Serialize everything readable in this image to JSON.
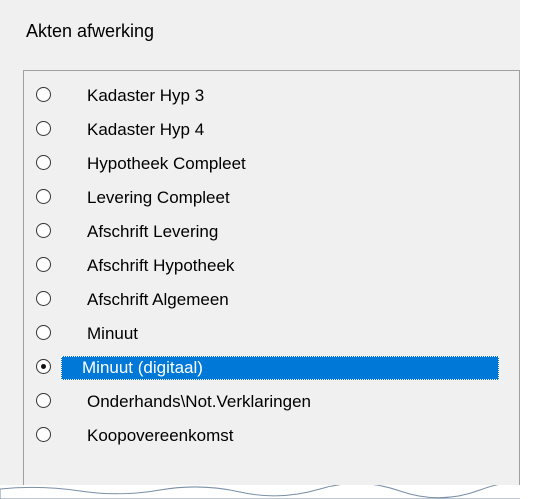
{
  "group": {
    "title": "Akten afwerking"
  },
  "options": [
    {
      "label": "Kadaster Hyp 3",
      "checked": false,
      "selected": false
    },
    {
      "label": "Kadaster Hyp 4",
      "checked": false,
      "selected": false
    },
    {
      "label": "Hypotheek Compleet",
      "checked": false,
      "selected": false
    },
    {
      "label": "Levering Compleet",
      "checked": false,
      "selected": false
    },
    {
      "label": "Afschrift Levering",
      "checked": false,
      "selected": false
    },
    {
      "label": "Afschrift Hypotheek",
      "checked": false,
      "selected": false
    },
    {
      "label": "Afschrift Algemeen",
      "checked": false,
      "selected": false
    },
    {
      "label": "Minuut",
      "checked": false,
      "selected": false
    },
    {
      "label": "Minuut (digitaal)",
      "checked": true,
      "selected": true
    },
    {
      "label": "Onderhands\\Not.Verklaringen",
      "checked": false,
      "selected": false
    },
    {
      "label": "Koopovereenkomst",
      "checked": false,
      "selected": false
    }
  ],
  "colors": {
    "selection": "#0078d7",
    "panel": "#f0f0f0"
  }
}
